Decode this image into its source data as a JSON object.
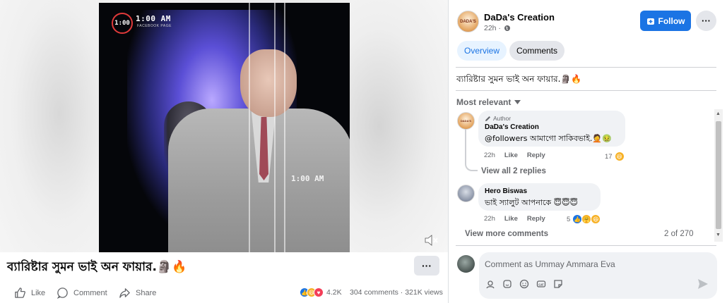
{
  "video": {
    "clock_badge": "1:00",
    "clock_text": "1:00 AM",
    "clock_sub": "FACEBOOK PAGE",
    "clock_mid": "1:00 AM"
  },
  "post": {
    "caption": "ব্যারিষ্টার সুমন ভাই অন ফায়ার.🗿🔥",
    "more_label": "···",
    "actions": {
      "like": "Like",
      "comment": "Comment",
      "share": "Share"
    },
    "reaction_count": "4.2K",
    "stats": "304 comments · 321K views"
  },
  "header": {
    "page_name": "DaDa's Creation",
    "time": "22h ·",
    "follow_label": "Follow",
    "more_label": "···",
    "avatar_text": "DADA'S"
  },
  "tabs": [
    {
      "label": "Overview",
      "active": true
    },
    {
      "label": "Comments",
      "active": false
    }
  ],
  "description": "ব্যারিষ্টার সুমন ভাই অন ফায়ার.🗿🔥",
  "sort_label": "Most relevant",
  "comments": [
    {
      "author_tag": "Author",
      "name": "DaDa's Creation",
      "text": "@followers আমাগো সাকিবভাই.🤦🤢",
      "time": "22h",
      "like": "Like",
      "reply": "Reply",
      "likes": "17",
      "avatar_text": "DADA'S"
    },
    {
      "name": "Hero Biswas",
      "text": "ভাই স্যালুট আপনাকে 😇😇😇",
      "time": "22h",
      "like": "Like",
      "reply": "Reply",
      "likes": "5"
    }
  ],
  "view_replies": "View all 2 replies",
  "view_more": "View more comments",
  "page_count": "2 of 270",
  "composer": {
    "placeholder": "Comment as Ummay Ammara Eva"
  },
  "colors": {
    "accent": "#1b74e4",
    "tab_bg": "#e7f3ff",
    "bubble": "#f0f2f5",
    "muted": "#65676b"
  }
}
